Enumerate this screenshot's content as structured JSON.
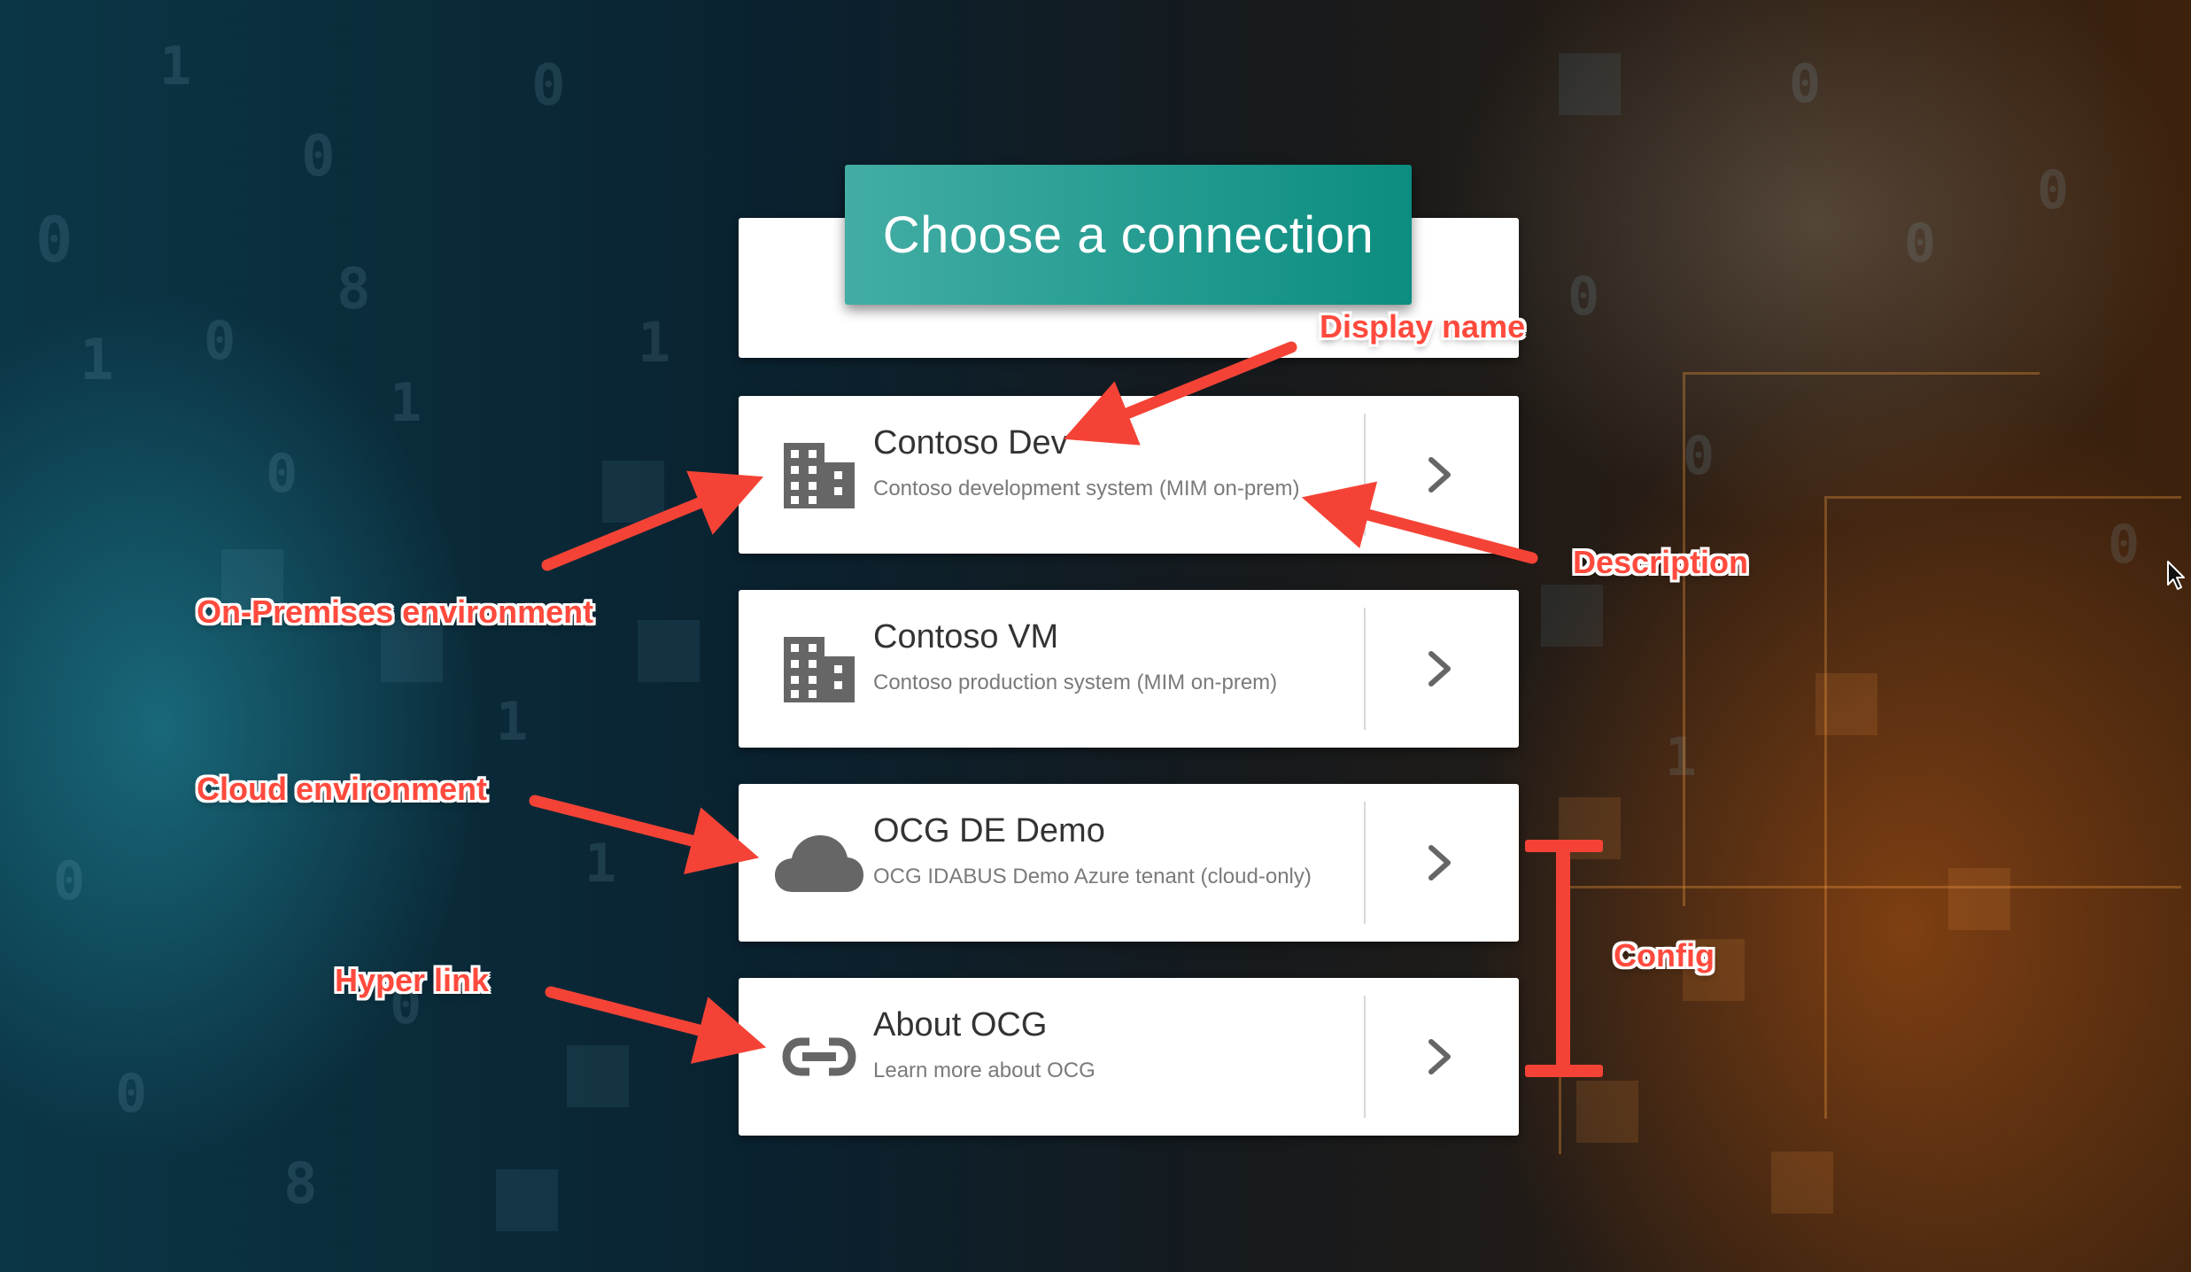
{
  "header": {
    "title": "Choose a connection"
  },
  "connections": [
    {
      "name": "Contoso Dev",
      "description": "Contoso development system (MIM on-prem)",
      "icon": "building-icon"
    },
    {
      "name": "Contoso VM",
      "description": "Contoso production system (MIM on-prem)",
      "icon": "building-icon"
    },
    {
      "name": "OCG DE Demo",
      "description": "OCG IDABUS Demo Azure tenant (cloud-only)",
      "icon": "cloud-icon"
    },
    {
      "name": "About OCG",
      "description": "Learn more about OCG",
      "icon": "link-icon"
    }
  ],
  "annotations": {
    "display_name": "Display name",
    "description": "Description",
    "on_premises": "On-Premises environment",
    "cloud": "Cloud environment",
    "hyper_link": "Hyper link",
    "config": "Config"
  },
  "colors": {
    "accent": "#199a8e",
    "annotation": "#ff4a3d",
    "icon": "#666666"
  }
}
